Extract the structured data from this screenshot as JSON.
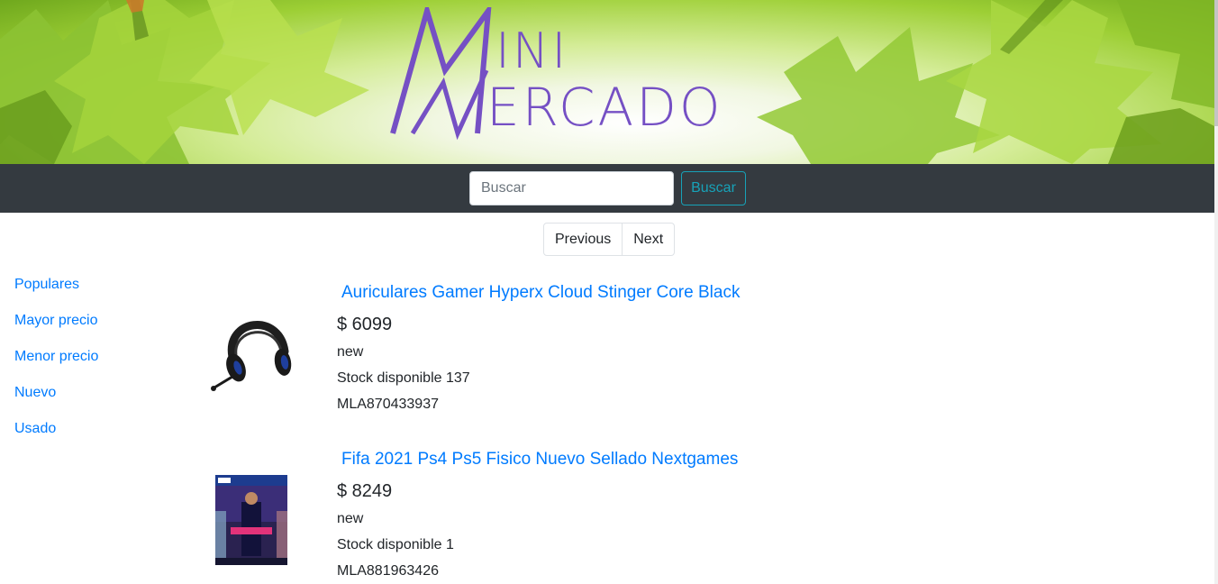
{
  "header": {
    "logo_line1": "INI",
    "logo_line2": "ERCADO",
    "logo_monogram": "M"
  },
  "search": {
    "placeholder": "Buscar",
    "value": "",
    "button_label": "Buscar"
  },
  "pagination": {
    "previous_label": "Previous",
    "next_label": "Next"
  },
  "sidebar": {
    "items": [
      {
        "label": "Populares"
      },
      {
        "label": "Mayor precio"
      },
      {
        "label": "Menor precio"
      },
      {
        "label": "Nuevo"
      },
      {
        "label": "Usado"
      }
    ]
  },
  "products": [
    {
      "title": "Auriculares Gamer Hyperx Cloud Stinger Core Black",
      "price": "$ 6099",
      "condition": "new",
      "stock": "Stock disponible 137",
      "id": "MLA870433937",
      "image_icon": "headset-image"
    },
    {
      "title": "Fifa 2021 Ps4 Ps5 Fisico Nuevo Sellado Nextgames",
      "price": "$ 8249",
      "condition": "new",
      "stock": "Stock disponible 1",
      "id": "MLA881963426",
      "image_icon": "game-cover-image"
    }
  ],
  "colors": {
    "accent": "#7550c4",
    "link": "#007bff",
    "navbar": "#343a40",
    "search_button": "#17a2b8"
  }
}
